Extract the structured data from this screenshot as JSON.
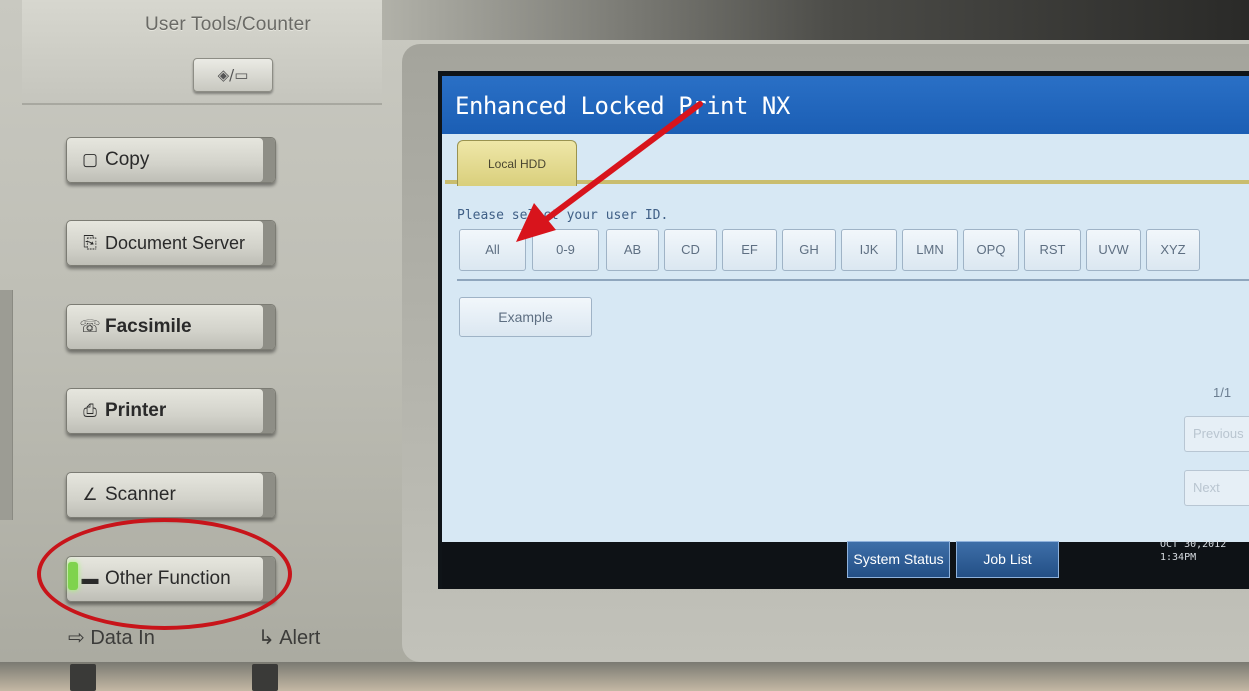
{
  "panel": {
    "user_tools_label": "User Tools/Counter",
    "user_tools_key_symbol": "◈/▭",
    "function_keys": [
      {
        "label": "Copy",
        "icon": "▢",
        "icon_name": "copy-icon"
      },
      {
        "label": "Document Server",
        "icon": "⎘",
        "icon_name": "document-server-icon"
      },
      {
        "label": "Facsimile",
        "icon": "☏",
        "icon_name": "facsimile-icon"
      },
      {
        "label": "Printer",
        "icon": "⎙",
        "icon_name": "printer-icon"
      },
      {
        "label": "Scanner",
        "icon": "∠",
        "icon_name": "scanner-icon"
      },
      {
        "label": "Other Function",
        "icon": "▬",
        "icon_name": "other-function-icon"
      }
    ],
    "data_in_label": "Data In",
    "alert_label": "Alert",
    "led_color": "#7fd34d"
  },
  "screen": {
    "title": "Enhanced Locked Print NX",
    "tab_label": "Local HDD",
    "prompt": "Please select your user ID.",
    "letter_buttons": [
      "All",
      "0-9",
      "AB",
      "CD",
      "EF",
      "GH",
      "IJK",
      "LMN",
      "OPQ",
      "RST",
      "UVW",
      "XYZ"
    ],
    "user_ids": [
      "Example"
    ],
    "page_indicator": "1/1",
    "prev_label": "Previous",
    "next_label": "Next",
    "system_status_label": "System Status",
    "job_list_label": "Job List",
    "date": "OCT  30,2012",
    "time": "1:34PM"
  },
  "annotations": {
    "arrow_color": "#d8141c",
    "ellipse_color": "#c8141a"
  }
}
